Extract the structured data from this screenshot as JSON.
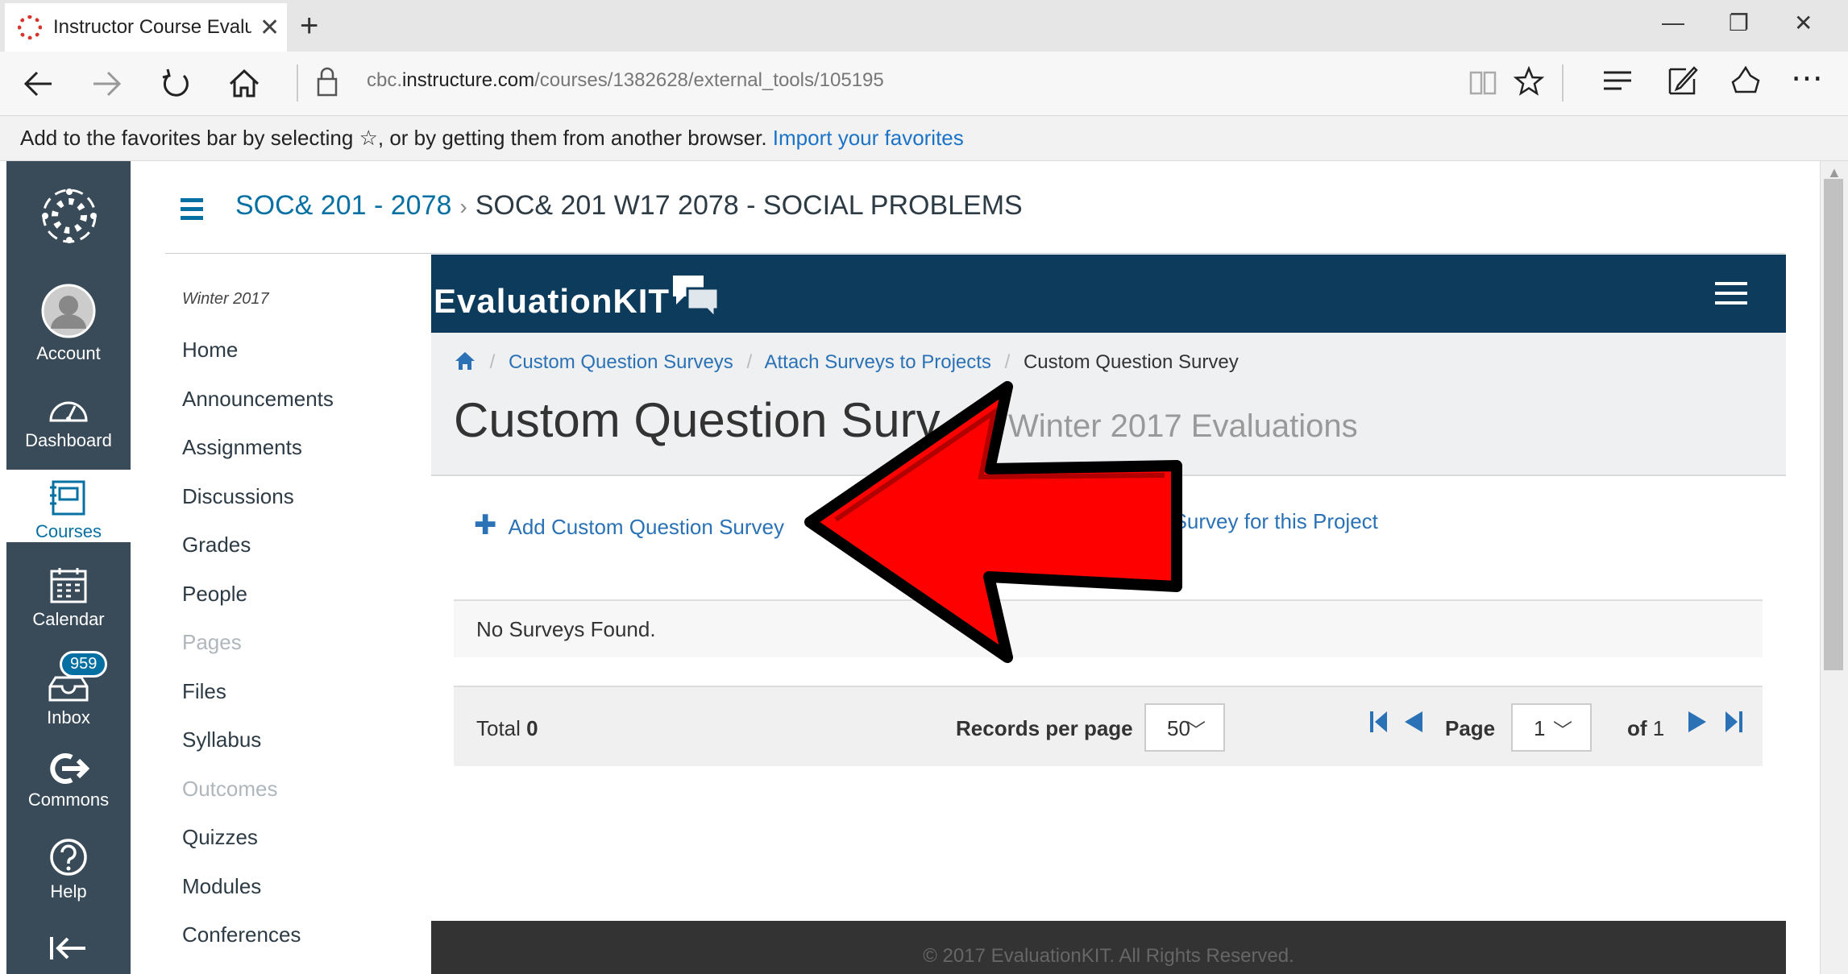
{
  "browser": {
    "tab_title": "Instructor Course Evaluа",
    "address_prefix": "cbc.",
    "address_domain": "instructure.com",
    "address_path": "/courses/1382628/external_tools/105195",
    "favbar_text": "Add to the favorites bar by selecting ☆, or by getting them from another browser.",
    "favbar_link": "Import your favorites"
  },
  "global_nav": {
    "account": "Account",
    "dashboard": "Dashboard",
    "courses": "Courses",
    "calendar": "Calendar",
    "inbox": "Inbox",
    "inbox_badge": "959",
    "commons": "Commons",
    "help": "Help"
  },
  "breadcrumb": {
    "course": "SOC& 201 - 2078",
    "separator": "›",
    "current": "SOC& 201 W17 2078 - SOCIAL PROBLEMS"
  },
  "course_nav": {
    "term": "Winter 2017",
    "items": [
      {
        "label": "Home"
      },
      {
        "label": "Announcements"
      },
      {
        "label": "Assignments"
      },
      {
        "label": "Discussions"
      },
      {
        "label": "Grades"
      },
      {
        "label": "People"
      },
      {
        "label": "Pages"
      },
      {
        "label": "Files"
      },
      {
        "label": "Syllabus"
      },
      {
        "label": "Outcomes"
      },
      {
        "label": "Quizzes"
      },
      {
        "label": "Modules"
      },
      {
        "label": "Conferences"
      }
    ]
  },
  "ek": {
    "logo": "EvaluationKIT",
    "crumbs": [
      "Custom Question Surveys",
      "Attach Surveys to Projects",
      "Custom Question Survey"
    ],
    "title": "Custom Question Surv",
    "subtitle": "Winter 2017 Evaluations",
    "add_action": "Add Custom Question Survey",
    "view_action": "w Main Survey for this Project",
    "empty": "No Surveys Found.",
    "total_label": "Total",
    "total_value": "0",
    "rpp_label": "Records per page",
    "rpp_value": "50",
    "page_label": "Page",
    "page_value": "1",
    "of_label": "of",
    "of_value": "1",
    "footer": "© 2017 EvaluationKIT. All Rights Reserved."
  },
  "colors": {
    "canvas_nav": "#394b58",
    "canvas_link": "#0770a3",
    "ek_header": "#0d3b5c",
    "ek_link": "#2a72b5",
    "annotation_arrow": "#ff0000"
  }
}
